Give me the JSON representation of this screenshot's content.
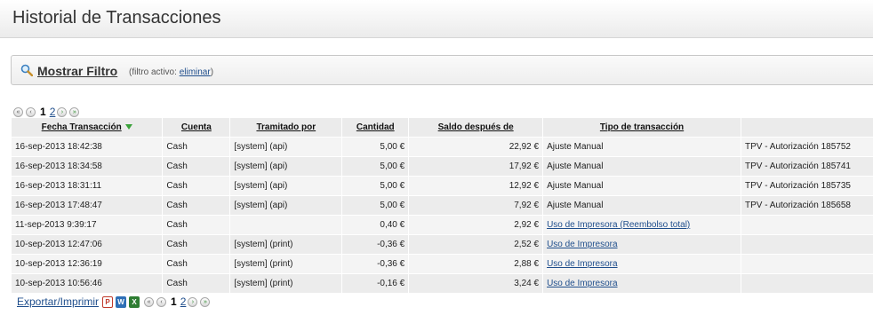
{
  "page": {
    "title": "Historial de Transacciones"
  },
  "filter": {
    "link_label": "Mostrar Filtro",
    "note_prefix": "(filtro activo: ",
    "remove_label": "eliminar",
    "note_suffix": ")"
  },
  "pagination": {
    "pages": [
      "1",
      "2"
    ],
    "current_page": "1",
    "first_icon": "first-page-icon",
    "prev_icon": "prev-page-icon",
    "next_icon": "next-page-icon",
    "last_icon": "last-page-icon"
  },
  "table": {
    "headers": {
      "fecha": "Fecha Transacción",
      "cuenta": "Cuenta",
      "tramitado": "Tramitado por",
      "cantidad": "Cantidad",
      "saldo": "Saldo después de",
      "tipo": "Tipo de transacción",
      "extra": ""
    },
    "sort_icon": "sort-desc-icon",
    "rows": [
      {
        "fecha": "16-sep-2013 18:42:38",
        "cuenta": "Cash",
        "tramitado": "[system] (api)",
        "cantidad": "5,00 €",
        "saldo": "22,92 €",
        "tipo": "Ajuste Manual",
        "tipo_link": false,
        "extra": "TPV - Autorización 185752"
      },
      {
        "fecha": "16-sep-2013 18:34:58",
        "cuenta": "Cash",
        "tramitado": "[system] (api)",
        "cantidad": "5,00 €",
        "saldo": "17,92 €",
        "tipo": "Ajuste Manual",
        "tipo_link": false,
        "extra": "TPV - Autorización 185741"
      },
      {
        "fecha": "16-sep-2013 18:31:11",
        "cuenta": "Cash",
        "tramitado": "[system] (api)",
        "cantidad": "5,00 €",
        "saldo": "12,92 €",
        "tipo": "Ajuste Manual",
        "tipo_link": false,
        "extra": "TPV - Autorización 185735"
      },
      {
        "fecha": "16-sep-2013 17:48:47",
        "cuenta": "Cash",
        "tramitado": "[system] (api)",
        "cantidad": "5,00 €",
        "saldo": "7,92 €",
        "tipo": "Ajuste Manual",
        "tipo_link": false,
        "extra": "TPV - Autorización 185658"
      },
      {
        "fecha": "11-sep-2013 9:39:17",
        "cuenta": "Cash",
        "tramitado": "",
        "cantidad": "0,40 €",
        "saldo": "2,92 €",
        "tipo": "Uso de Impresora (Reembolso total)",
        "tipo_link": true,
        "extra": ""
      },
      {
        "fecha": "10-sep-2013 12:47:06",
        "cuenta": "Cash",
        "tramitado": "[system] (print)",
        "cantidad": "-0,36 €",
        "saldo": "2,52 €",
        "tipo": "Uso de Impresora",
        "tipo_link": true,
        "extra": ""
      },
      {
        "fecha": "10-sep-2013 12:36:19",
        "cuenta": "Cash",
        "tramitado": "[system] (print)",
        "cantidad": "-0,36 €",
        "saldo": "2,88 €",
        "tipo": "Uso de Impresora",
        "tipo_link": true,
        "extra": ""
      },
      {
        "fecha": "10-sep-2013 10:56:46",
        "cuenta": "Cash",
        "tramitado": "[system] (print)",
        "cantidad": "-0,16 €",
        "saldo": "3,24 €",
        "tipo": "Uso de Impresora",
        "tipo_link": true,
        "extra": ""
      }
    ]
  },
  "footer": {
    "export_label": "Exportar/Imprimir",
    "icons": [
      "pdf-icon",
      "document-icon",
      "excel-icon"
    ]
  },
  "colors": {
    "link": "#1f4e8c",
    "sort_arrow": "#3aa23a"
  }
}
